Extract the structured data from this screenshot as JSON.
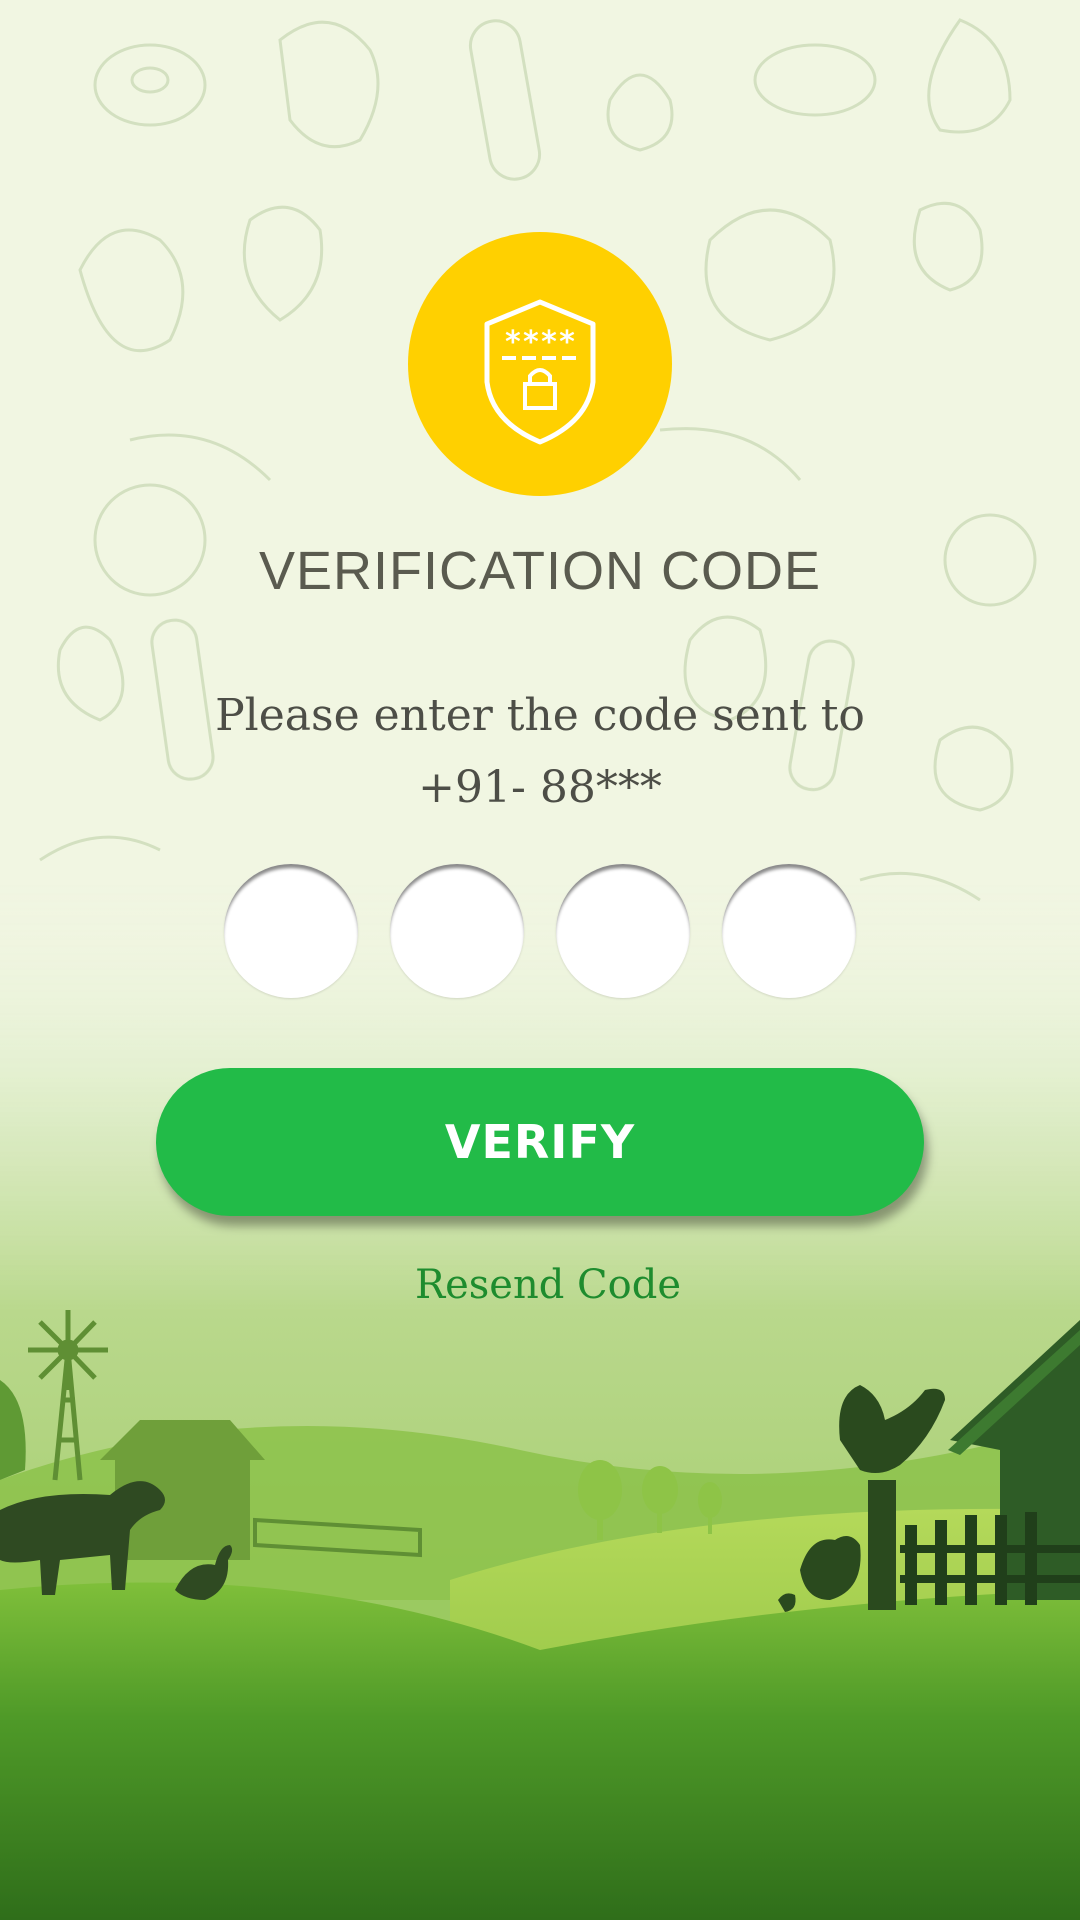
{
  "screen": {
    "title": "VERIFICATION CODE",
    "instruction_line1": "Please enter the code sent to",
    "instruction_line2": "+91- 88***"
  },
  "otp": {
    "digits": [
      "",
      "",
      "",
      ""
    ]
  },
  "actions": {
    "verify_label": "VERIFY",
    "resend_label": "Resend Code"
  },
  "badge": {
    "icon": "shield-lock-icon",
    "masked_code": "****"
  },
  "colors": {
    "accent_yellow": "#ffd000",
    "button_green": "#22bb48",
    "link_green": "#1e8c2e",
    "title_gray": "#5a5b4f",
    "background": "#f1f6e2"
  }
}
